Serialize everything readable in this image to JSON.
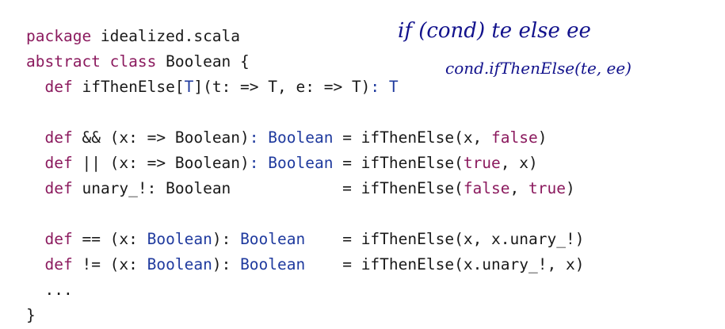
{
  "code_lines": [
    [
      {
        "t": "package",
        "c": "kw"
      },
      {
        "t": " idealized.scala",
        "c": ""
      }
    ],
    [
      {
        "t": "abstract class",
        "c": "kw"
      },
      {
        "t": " Boolean {",
        "c": ""
      }
    ],
    [
      {
        "t": "  ",
        "c": ""
      },
      {
        "t": "def",
        "c": "kw"
      },
      {
        "t": " ifThenElse[",
        "c": ""
      },
      {
        "t": "T",
        "c": "ty"
      },
      {
        "t": "](t: => T, e: => T)",
        "c": ""
      },
      {
        "t": ": T",
        "c": "ty"
      }
    ],
    [
      {
        "t": "",
        "c": ""
      }
    ],
    [
      {
        "t": "  ",
        "c": ""
      },
      {
        "t": "def",
        "c": "kw"
      },
      {
        "t": " && (x: => Boolean)",
        "c": ""
      },
      {
        "t": ": Boolean",
        "c": "ty"
      },
      {
        "t": " = ifThenElse(x, ",
        "c": ""
      },
      {
        "t": "false",
        "c": "kw"
      },
      {
        "t": ")",
        "c": ""
      }
    ],
    [
      {
        "t": "  ",
        "c": ""
      },
      {
        "t": "def",
        "c": "kw"
      },
      {
        "t": " || (x: => Boolean)",
        "c": ""
      },
      {
        "t": ": Boolean",
        "c": "ty"
      },
      {
        "t": " = ifThenElse(",
        "c": ""
      },
      {
        "t": "true",
        "c": "kw"
      },
      {
        "t": ", x)",
        "c": ""
      }
    ],
    [
      {
        "t": "  ",
        "c": ""
      },
      {
        "t": "def",
        "c": "kw"
      },
      {
        "t": " unary_!: Boolean            = ifThenElse(",
        "c": ""
      },
      {
        "t": "false",
        "c": "kw"
      },
      {
        "t": ", ",
        "c": ""
      },
      {
        "t": "true",
        "c": "kw"
      },
      {
        "t": ")",
        "c": ""
      }
    ],
    [
      {
        "t": "",
        "c": ""
      }
    ],
    [
      {
        "t": "  ",
        "c": ""
      },
      {
        "t": "def",
        "c": "kw"
      },
      {
        "t": " == (x: ",
        "c": ""
      },
      {
        "t": "Boolean",
        "c": "ty"
      },
      {
        "t": "): ",
        "c": ""
      },
      {
        "t": "Boolean",
        "c": "ty"
      },
      {
        "t": "    = ifThenElse(x, x.unary_!)",
        "c": ""
      }
    ],
    [
      {
        "t": "  ",
        "c": ""
      },
      {
        "t": "def",
        "c": "kw"
      },
      {
        "t": " != (x: ",
        "c": ""
      },
      {
        "t": "Boolean",
        "c": "ty"
      },
      {
        "t": "): ",
        "c": ""
      },
      {
        "t": "Boolean",
        "c": "ty"
      },
      {
        "t": "    = ifThenElse(x.unary_!, x)",
        "c": ""
      }
    ],
    [
      {
        "t": "  ...",
        "c": ""
      }
    ],
    [
      {
        "t": "}",
        "c": ""
      }
    ]
  ],
  "annotations": {
    "line1": "if (cond) te else ee",
    "line2": "cond.ifThenElse(te, ee)"
  },
  "colors": {
    "keyword": "#8b1a5e",
    "type": "#1f3a9e",
    "text": "#1a1a1a",
    "handwriting": "#12128c"
  }
}
